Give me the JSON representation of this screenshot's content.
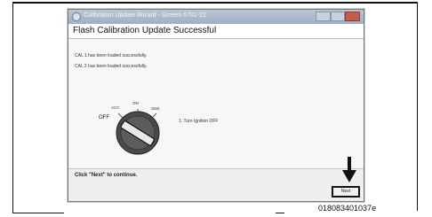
{
  "window": {
    "title": "Calibration Update Wizard - Screen 5701-22",
    "controls": [
      "minimize",
      "maximize",
      "close"
    ]
  },
  "header": {
    "title": "Flash Calibration Update Successful"
  },
  "messages": [
    "CAL 1 has been loaded successfully.",
    "CAL 2 has been loaded successfully."
  ],
  "dial": {
    "labels": {
      "off": "OFF",
      "acc": "ACC",
      "on": "ON",
      "start": "Start"
    }
  },
  "instruction": "1. Turn Ignition OFF",
  "footer": {
    "prompt": "Click \"Next\" to continue.",
    "next_label": "Next"
  },
  "figure_id": "018083401037e",
  "colors": {
    "titlebar": "#a9b9cc",
    "close_button": "#c45b4e",
    "background": "#f7f7f7"
  }
}
